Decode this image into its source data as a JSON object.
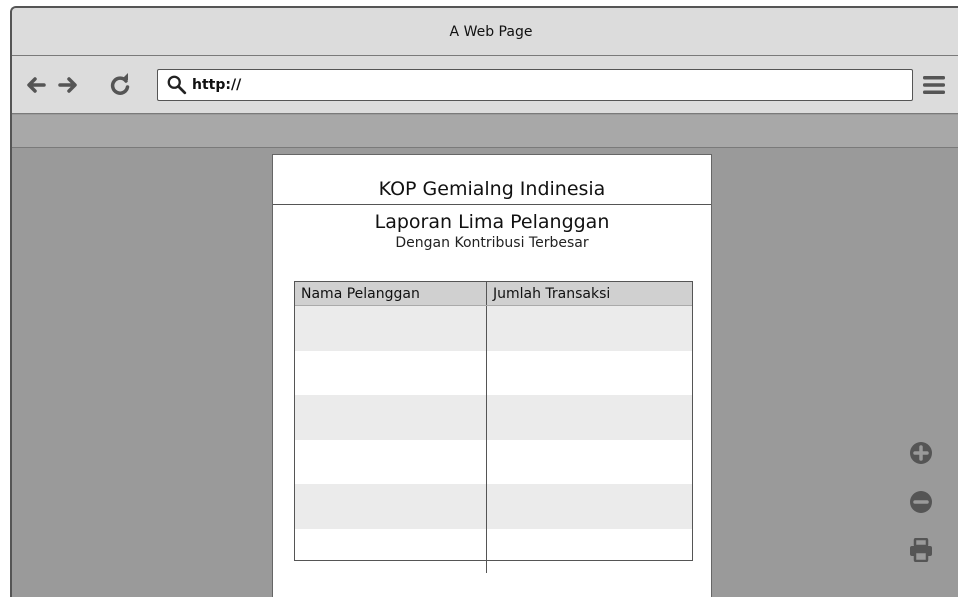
{
  "window": {
    "title": "A Web Page"
  },
  "toolbar": {
    "url": "http://"
  },
  "report": {
    "header": "KOP Gemialng Indinesia",
    "title": "Laporan Lima Pelanggan",
    "subtitle": "Dengan Kontribusi Terbesar",
    "table": {
      "columns": [
        "Nama Pelanggan",
        "Jumlah Transaksi"
      ],
      "rows": [
        [
          "",
          ""
        ],
        [
          "",
          ""
        ],
        [
          "",
          ""
        ],
        [
          "",
          ""
        ],
        [
          "",
          ""
        ],
        [
          "",
          ""
        ]
      ]
    }
  },
  "icons": {
    "back": "arrow-left-icon",
    "forward": "arrow-right-icon",
    "refresh": "refresh-icon",
    "search": "search-icon",
    "menu": "hamburger-menu-icon",
    "zoom_in": "zoom-in-icon",
    "zoom_out": "zoom-out-icon",
    "print": "print-icon"
  },
  "colors": {
    "window_bg": "#9a9a9a",
    "chrome": "#dcdcdc",
    "row_alt": "#ebebeb",
    "header_row": "#d0d0d0"
  }
}
